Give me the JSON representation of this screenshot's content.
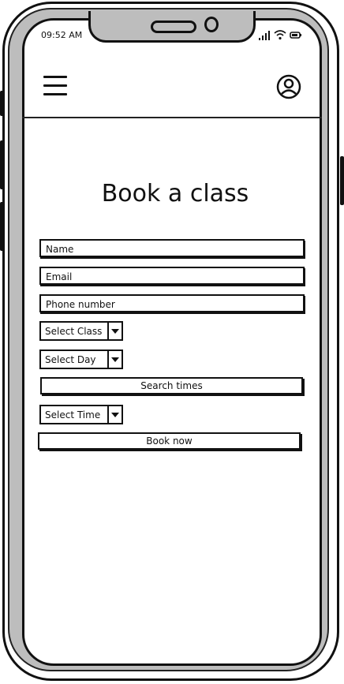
{
  "status": {
    "time": "09:52 AM"
  },
  "header": {
    "menu_icon": "hamburger-menu-icon",
    "profile_icon": "user-circle-icon"
  },
  "page": {
    "title": "Book a class"
  },
  "form": {
    "name_placeholder": "Name",
    "email_placeholder": "Email",
    "phone_placeholder": "Phone number",
    "class_select": "Select Class",
    "day_select": "Select Day",
    "search_button": "Search times",
    "time_select": "Select Time",
    "book_button": "Book now"
  }
}
